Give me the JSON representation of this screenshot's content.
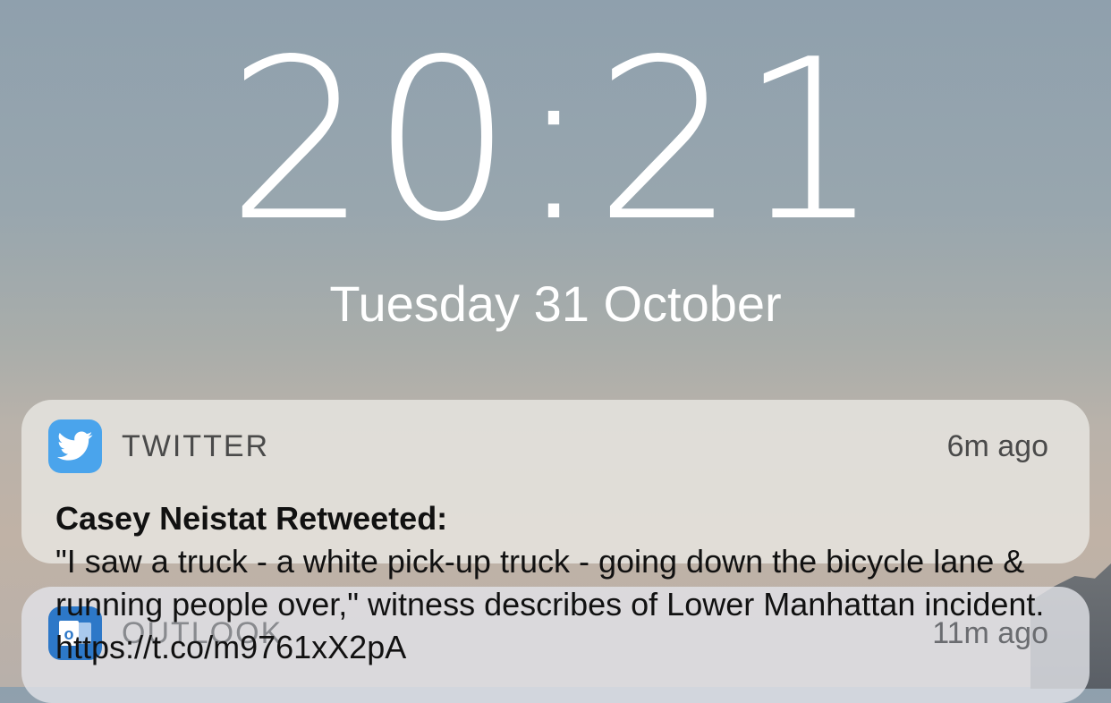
{
  "lockscreen": {
    "time": "20:21",
    "date": "Tuesday 31 October"
  },
  "notifications": [
    {
      "app": "TWITTER",
      "icon": "twitter-bird-icon",
      "icon_color": "#4aa4ec",
      "time_ago": "6m ago",
      "title": "Casey Neistat Retweeted:",
      "body": "\"I saw a truck - a white pick-up truck - going down the bicycle lane & running people over,\" witness describes of Lower Manhattan incident. https://t.co/m9761xX2pA"
    },
    {
      "app": "OUTLOOK",
      "icon": "outlook-icon",
      "icon_color": "#2d78c8",
      "time_ago": "11m ago"
    }
  ]
}
